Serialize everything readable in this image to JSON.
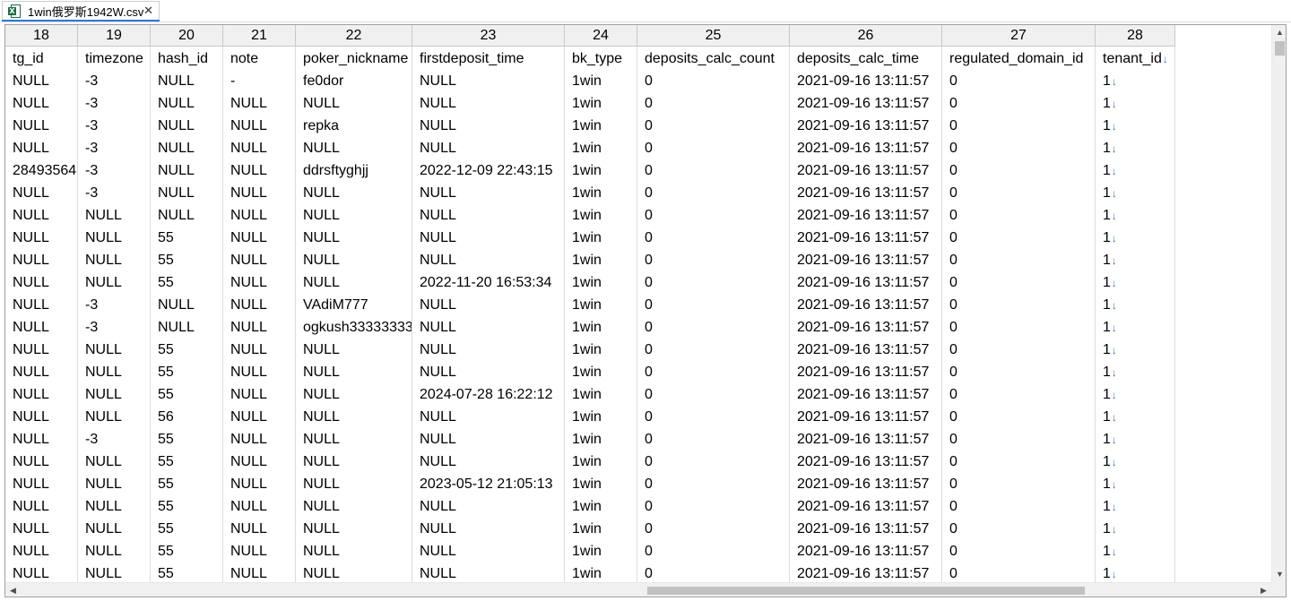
{
  "tab": {
    "title": "1win俄罗斯1942W.csv",
    "close": "✕",
    "icon": "excel-file-icon"
  },
  "columns": [
    {
      "num": "18",
      "name": "tg_id"
    },
    {
      "num": "19",
      "name": "timezone"
    },
    {
      "num": "20",
      "name": "hash_id"
    },
    {
      "num": "21",
      "name": "note"
    },
    {
      "num": "22",
      "name": "poker_nickname"
    },
    {
      "num": "23",
      "name": "firstdeposit_time"
    },
    {
      "num": "24",
      "name": "bk_type"
    },
    {
      "num": "25",
      "name": "deposits_calc_count"
    },
    {
      "num": "26",
      "name": "deposits_calc_time"
    },
    {
      "num": "27",
      "name": "regulated_domain_id"
    },
    {
      "num": "28",
      "name": "tenant_id"
    }
  ],
  "rows": [
    [
      "NULL",
      "-3",
      "NULL",
      "-",
      "fe0dor",
      "NULL",
      "1win",
      "0",
      "2021-09-16 13:11:57",
      "0",
      "1"
    ],
    [
      "NULL",
      "-3",
      "NULL",
      "NULL",
      "NULL",
      "NULL",
      "1win",
      "0",
      "2021-09-16 13:11:57",
      "0",
      "1"
    ],
    [
      "NULL",
      "-3",
      "NULL",
      "NULL",
      "repka",
      "NULL",
      "1win",
      "0",
      "2021-09-16 13:11:57",
      "0",
      "1"
    ],
    [
      "NULL",
      "-3",
      "NULL",
      "NULL",
      "NULL",
      "NULL",
      "1win",
      "0",
      "2021-09-16 13:11:57",
      "0",
      "1"
    ],
    [
      "28493564",
      "-3",
      "NULL",
      "NULL",
      "ddrsftyghjj",
      "2022-12-09 22:43:15",
      "1win",
      "0",
      "2021-09-16 13:11:57",
      "0",
      "1"
    ],
    [
      "NULL",
      "-3",
      "NULL",
      "NULL",
      "NULL",
      "NULL",
      "1win",
      "0",
      "2021-09-16 13:11:57",
      "0",
      "1"
    ],
    [
      "NULL",
      "NULL",
      "NULL",
      "NULL",
      "NULL",
      "NULL",
      "1win",
      "0",
      "2021-09-16 13:11:57",
      "0",
      "1"
    ],
    [
      "NULL",
      "NULL",
      "55",
      "NULL",
      "NULL",
      "NULL",
      "1win",
      "0",
      "2021-09-16 13:11:57",
      "0",
      "1"
    ],
    [
      "NULL",
      "NULL",
      "55",
      "NULL",
      "NULL",
      "NULL",
      "1win",
      "0",
      "2021-09-16 13:11:57",
      "0",
      "1"
    ],
    [
      "NULL",
      "NULL",
      "55",
      "NULL",
      "NULL",
      "2022-11-20 16:53:34",
      "1win",
      "0",
      "2021-09-16 13:11:57",
      "0",
      "1"
    ],
    [
      "NULL",
      "-3",
      "NULL",
      "NULL",
      "VAdiM777",
      "NULL",
      "1win",
      "0",
      "2021-09-16 13:11:57",
      "0",
      "1"
    ],
    [
      "NULL",
      "-3",
      "NULL",
      "NULL",
      "ogkush33333333",
      "NULL",
      "1win",
      "0",
      "2021-09-16 13:11:57",
      "0",
      "1"
    ],
    [
      "NULL",
      "NULL",
      "55",
      "NULL",
      "NULL",
      "NULL",
      "1win",
      "0",
      "2021-09-16 13:11:57",
      "0",
      "1"
    ],
    [
      "NULL",
      "NULL",
      "55",
      "NULL",
      "NULL",
      "NULL",
      "1win",
      "0",
      "2021-09-16 13:11:57",
      "0",
      "1"
    ],
    [
      "NULL",
      "NULL",
      "55",
      "NULL",
      "NULL",
      "2024-07-28 16:22:12",
      "1win",
      "0",
      "2021-09-16 13:11:57",
      "0",
      "1"
    ],
    [
      "NULL",
      "NULL",
      "56",
      "NULL",
      "NULL",
      "NULL",
      "1win",
      "0",
      "2021-09-16 13:11:57",
      "0",
      "1"
    ],
    [
      "NULL",
      "-3",
      "55",
      "NULL",
      "NULL",
      "NULL",
      "1win",
      "0",
      "2021-09-16 13:11:57",
      "0",
      "1"
    ],
    [
      "NULL",
      "NULL",
      "55",
      "NULL",
      "NULL",
      "NULL",
      "1win",
      "0",
      "2021-09-16 13:11:57",
      "0",
      "1"
    ],
    [
      "NULL",
      "NULL",
      "55",
      "NULL",
      "NULL",
      "2023-05-12 21:05:13",
      "1win",
      "0",
      "2021-09-16 13:11:57",
      "0",
      "1"
    ],
    [
      "NULL",
      "NULL",
      "55",
      "NULL",
      "NULL",
      "NULL",
      "1win",
      "0",
      "2021-09-16 13:11:57",
      "0",
      "1"
    ],
    [
      "NULL",
      "NULL",
      "55",
      "NULL",
      "NULL",
      "NULL",
      "1win",
      "0",
      "2021-09-16 13:11:57",
      "0",
      "1"
    ],
    [
      "NULL",
      "NULL",
      "55",
      "NULL",
      "NULL",
      "NULL",
      "1win",
      "0",
      "2021-09-16 13:11:57",
      "0",
      "1"
    ],
    [
      "NULL",
      "NULL",
      "55",
      "NULL",
      "NULL",
      "NULL",
      "1win",
      "0",
      "2021-09-16 13:11:57",
      "0",
      "1"
    ]
  ],
  "linebreak_marker": "↓",
  "scroll": {
    "up": "▲",
    "down": "▼",
    "left": "◀",
    "right": "▶"
  },
  "colors": {
    "accent": "#2b79d6",
    "header_bg": "#f0f0f0",
    "grid_line": "#dcdcdc"
  }
}
